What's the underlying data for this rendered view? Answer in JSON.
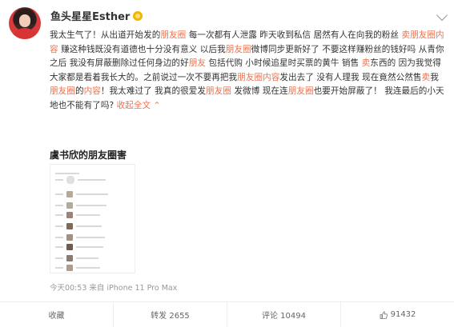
{
  "post": {
    "username": "鱼头星星Esther",
    "text_segments": [
      {
        "t": "我太生气了！从出道开始发的"
      },
      {
        "t": "朋友圈",
        "k": true
      },
      {
        "t": " 每一次都有人泄露 昨天收到私信 居然有人在向我的粉丝 "
      },
      {
        "t": "卖朋友圈内容",
        "k": true
      },
      {
        "t": " 赚这种钱既没有道德也十分没有意义 以后我"
      },
      {
        "t": "朋友圈",
        "k": true
      },
      {
        "t": "微博同步更新好了 不要这样赚粉丝的钱好吗 从青你之后 我没有屏蔽删除过任何身边的好"
      },
      {
        "t": "朋友",
        "k": true
      },
      {
        "t": " 包括代购 小时候追星时买票的黄牛 销售 "
      },
      {
        "t": "卖",
        "k": true
      },
      {
        "t": "东西的 因为我觉得大家都是看着我长大的。之前说过一次不要再把我"
      },
      {
        "t": "朋友圈内容",
        "k": true
      },
      {
        "t": "发出去了 没有人理我 现在竟然公然售"
      },
      {
        "t": "卖",
        "k": true
      },
      {
        "t": "我"
      },
      {
        "t": "朋友圈",
        "k": true
      },
      {
        "t": "的"
      },
      {
        "t": "内容",
        "k": true
      },
      {
        "t": "！我太难过了 我真的很爱发"
      },
      {
        "t": "朋友圈",
        "k": true
      },
      {
        "t": " 发微博 现在连"
      },
      {
        "t": "朋友圈",
        "k": true
      },
      {
        "t": "也要开始屏蔽了！ 我连最后的小天地也不能有了吗? "
      }
    ],
    "more_label": "收起全文 ⌃",
    "image_caption": "虞书欣的朋友圈害",
    "meta": "今天00:53 来自 iPhone 11 Pro Max"
  },
  "actions": {
    "favorite": "收藏",
    "repost": "转发 2655",
    "comment": "评论 10494",
    "like": "91432"
  },
  "colors": {
    "keyword": "#eb7350",
    "text": "#333333",
    "meta": "#999999"
  }
}
